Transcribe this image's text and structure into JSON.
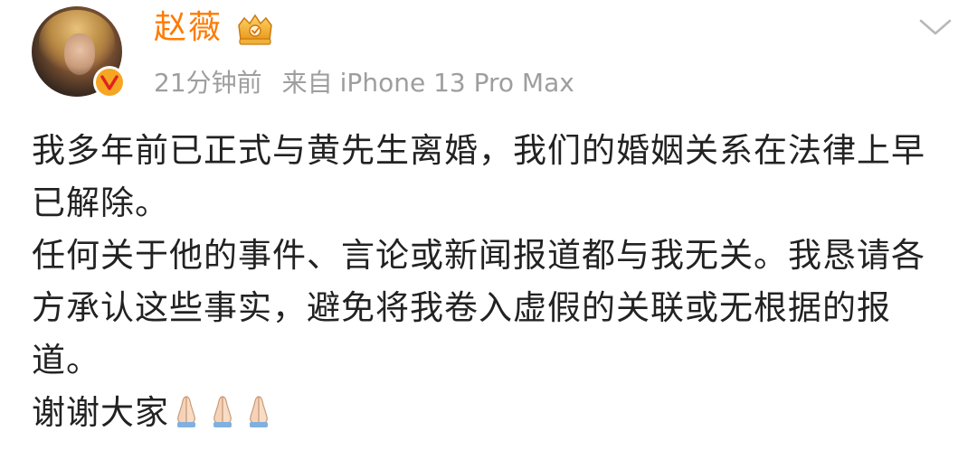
{
  "author": {
    "name": "赵薇",
    "verified_icon": "verified-v-badge-icon",
    "level_icon": "crown-level-icon"
  },
  "meta": {
    "time": "21分钟前",
    "source_label": "来自",
    "device": "iPhone 13 Pro Max"
  },
  "post": {
    "line1": "我多年前已正式与黄先生离婚，我们的婚姻关系在法律上早已解除。",
    "line2": "任何关于他的事件、言论或新闻报道都与我无关。我恳请各方承认这些事实，避免将我卷入虚假的关联或无根据的报道。",
    "line3": "谢谢大家",
    "emojis": [
      "folded-hands-icon",
      "folded-hands-icon",
      "folded-hands-icon"
    ]
  },
  "colors": {
    "name": "#ff7a00",
    "meta": "#9e9e9e",
    "text": "#222222",
    "badge": "#f5a623"
  }
}
